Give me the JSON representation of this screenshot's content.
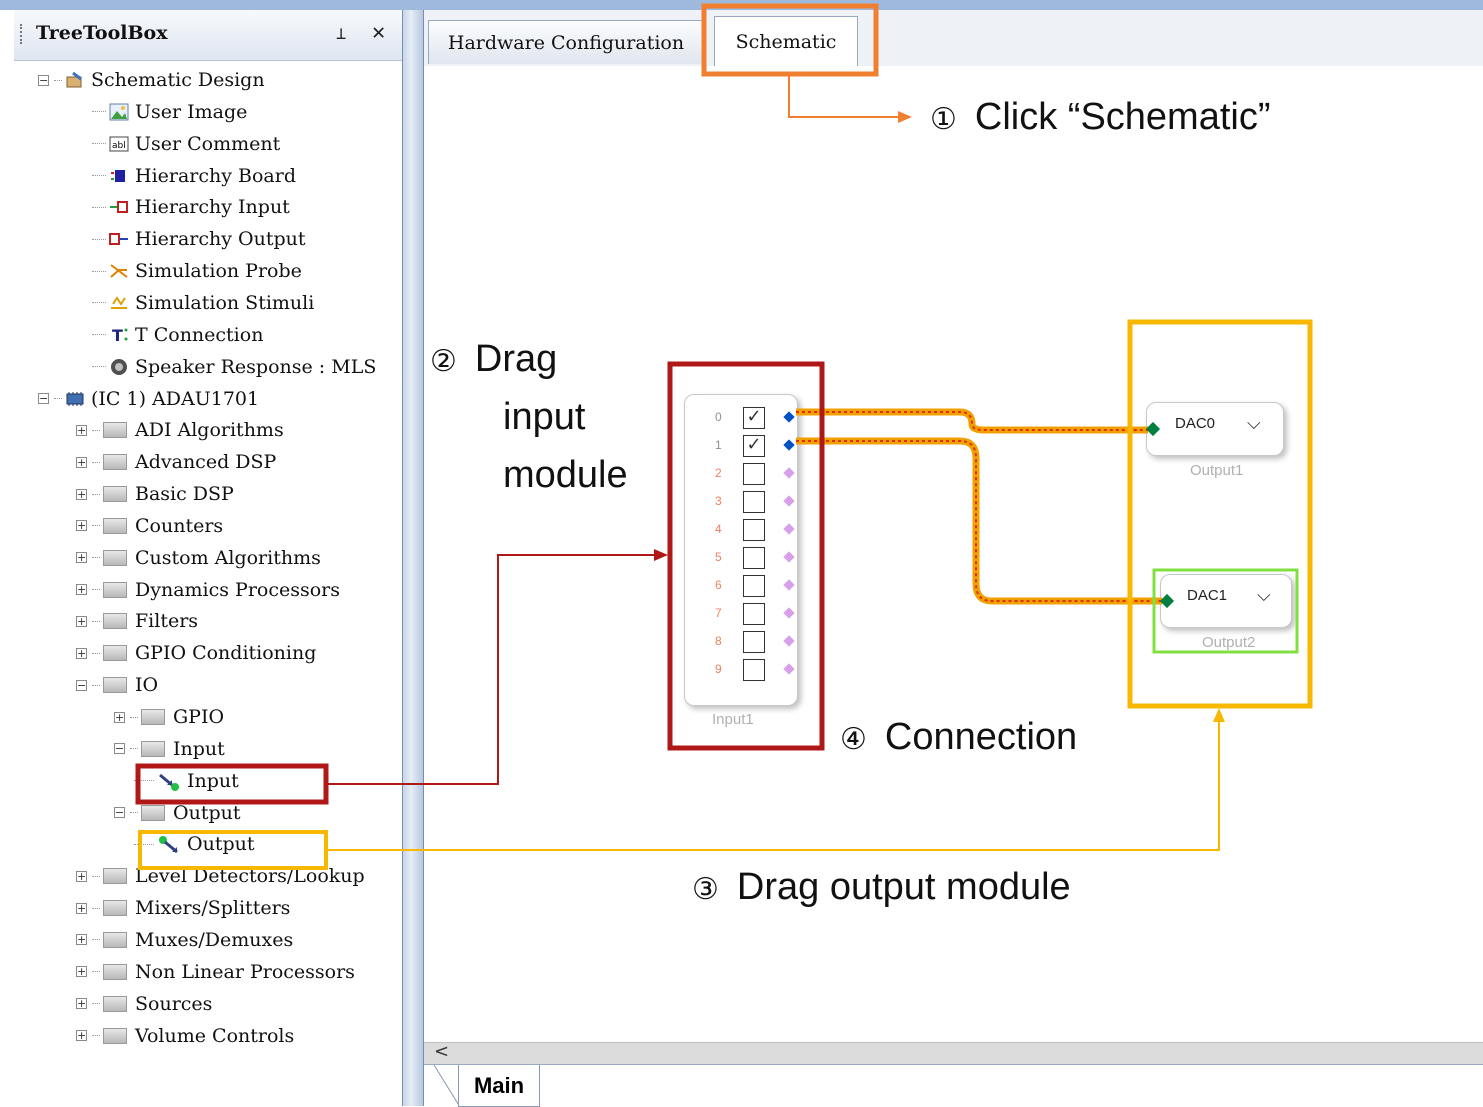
{
  "tree_toolbox": {
    "title": "TreeToolBox",
    "pin_glyph": "⊥",
    "close_glyph": "✕",
    "items": [
      {
        "label": "Schematic Design",
        "level": 0,
        "expander": "−",
        "icon": "schematic-design-icon"
      },
      {
        "label": "User Image",
        "level": 1,
        "icon": "user-image-icon"
      },
      {
        "label": "User Comment",
        "level": 1,
        "icon": "user-comment-icon"
      },
      {
        "label": "Hierarchy Board",
        "level": 1,
        "icon": "hierarchy-board-icon"
      },
      {
        "label": "Hierarchy Input",
        "level": 1,
        "icon": "hierarchy-input-icon"
      },
      {
        "label": "Hierarchy Output",
        "level": 1,
        "icon": "hierarchy-output-icon"
      },
      {
        "label": "Simulation Probe",
        "level": 1,
        "icon": "simulation-probe-icon"
      },
      {
        "label": "Simulation Stimuli",
        "level": 1,
        "icon": "simulation-stimuli-icon"
      },
      {
        "label": "T Connection",
        "level": 1,
        "icon": "t-connection-icon"
      },
      {
        "label": "Speaker Response : MLS",
        "level": 1,
        "icon": "speaker-response-icon"
      },
      {
        "label": "(IC 1) ADAU1701",
        "level": 0,
        "expander": "−",
        "icon": "ic-chip-icon"
      },
      {
        "label": "ADI Algorithms",
        "level": 1,
        "expander": "+",
        "icon": "folder-icon"
      },
      {
        "label": "Advanced DSP",
        "level": 1,
        "expander": "+",
        "icon": "folder-icon"
      },
      {
        "label": "Basic DSP",
        "level": 1,
        "expander": "+",
        "icon": "folder-icon"
      },
      {
        "label": "Counters",
        "level": 1,
        "expander": "+",
        "icon": "folder-icon"
      },
      {
        "label": "Custom Algorithms",
        "level": 1,
        "expander": "+",
        "icon": "folder-icon"
      },
      {
        "label": "Dynamics Processors",
        "level": 1,
        "expander": "+",
        "icon": "folder-icon"
      },
      {
        "label": "Filters",
        "level": 1,
        "expander": "+",
        "icon": "folder-icon"
      },
      {
        "label": "GPIO Conditioning",
        "level": 1,
        "expander": "+",
        "icon": "folder-icon"
      },
      {
        "label": "IO",
        "level": 1,
        "expander": "−",
        "icon": "folder-icon"
      },
      {
        "label": "GPIO",
        "level": 2,
        "expander": "+",
        "icon": "folder-icon"
      },
      {
        "label": "Input",
        "level": 2,
        "expander": "−",
        "icon": "folder-icon"
      },
      {
        "label": "Input",
        "level": 3,
        "icon": "input-module-icon"
      },
      {
        "label": "Output",
        "level": 2,
        "expander": "−",
        "icon": "folder-icon"
      },
      {
        "label": "Output",
        "level": 3,
        "icon": "output-module-icon"
      },
      {
        "label": "Level Detectors/Lookup",
        "level": 1,
        "expander": "+",
        "icon": "folder-icon"
      },
      {
        "label": "Mixers/Splitters",
        "level": 1,
        "expander": "+",
        "icon": "folder-icon"
      },
      {
        "label": "Muxes/Demuxes",
        "level": 1,
        "expander": "+",
        "icon": "folder-icon"
      },
      {
        "label": "Non Linear Processors",
        "level": 1,
        "expander": "+",
        "icon": "folder-icon"
      },
      {
        "label": "Sources",
        "level": 1,
        "expander": "+",
        "icon": "folder-icon"
      },
      {
        "label": "Volume Controls",
        "level": 1,
        "expander": "+",
        "icon": "folder-icon"
      }
    ]
  },
  "tabs": {
    "hardware": "Hardware Configuration",
    "schematic": "Schematic",
    "bottom_main": "Main"
  },
  "hscroll_left_glyph": "<",
  "schematic": {
    "input_module": {
      "caption": "Input1",
      "channels": [
        {
          "num": "0",
          "checked": true
        },
        {
          "num": "1",
          "checked": true
        },
        {
          "num": "2",
          "checked": false
        },
        {
          "num": "3",
          "checked": false
        },
        {
          "num": "4",
          "checked": false
        },
        {
          "num": "5",
          "checked": false
        },
        {
          "num": "6",
          "checked": false
        },
        {
          "num": "7",
          "checked": false
        },
        {
          "num": "8",
          "checked": false
        },
        {
          "num": "9",
          "checked": false
        }
      ]
    },
    "output1": {
      "value": "DAC0",
      "caption": "Output1"
    },
    "output2": {
      "value": "DAC1",
      "caption": "Output2"
    },
    "chevron_glyph": "⌵"
  },
  "annotations": {
    "step1": {
      "num": "①",
      "text": "Click “Schematic”"
    },
    "step2": {
      "num": "②",
      "line1": "Drag",
      "line2": "input",
      "line3": "module"
    },
    "step3": {
      "num": "③",
      "text": "Drag output module"
    },
    "step4": {
      "num": "④",
      "text": "Connection"
    }
  },
  "colors": {
    "orange_highlight": "#f08030",
    "red_highlight": "#b01818",
    "yellow_highlight": "#f8b800",
    "green_highlight": "#80e040",
    "wire": "#f0a000",
    "wire_dash": "#e03000",
    "pin_active": "#0050c8",
    "pin_inactive": "#d8a0e8",
    "pin_output": "#008040"
  }
}
